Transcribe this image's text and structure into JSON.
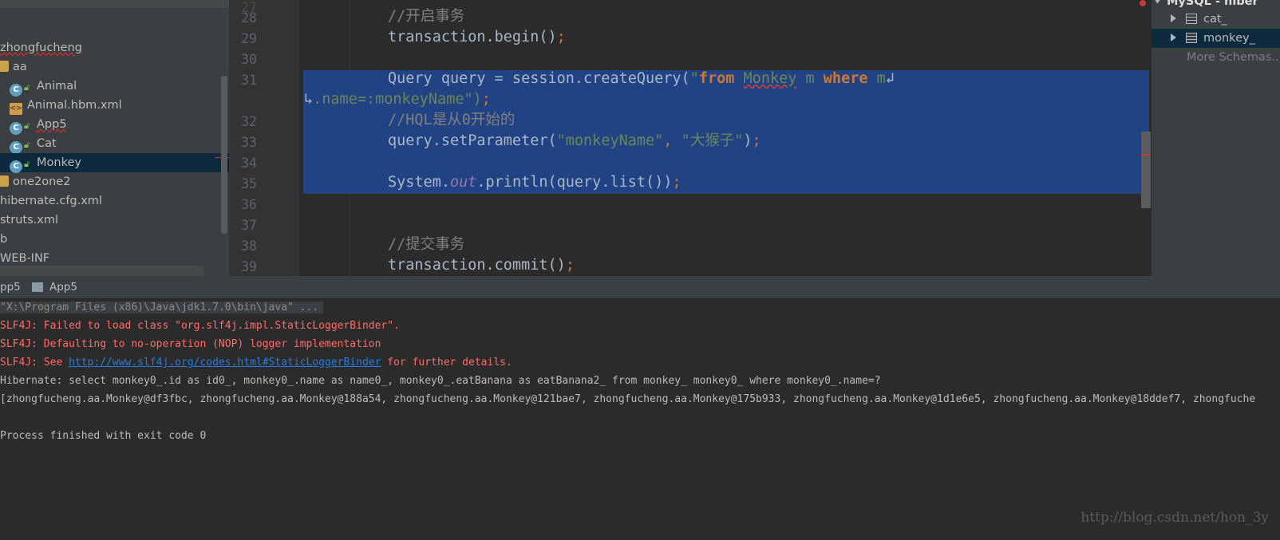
{
  "project_tree": {
    "items": [
      {
        "label": "zhongfucheng"
      },
      {
        "label": "aa"
      },
      {
        "label": "Animal",
        "badge": "C"
      },
      {
        "label": "Animal.hbm.xml"
      },
      {
        "label": "App5",
        "badge": "C"
      },
      {
        "label": "Cat",
        "badge": "C"
      },
      {
        "label": "Monkey",
        "badge": "C"
      },
      {
        "label": "one2one2"
      },
      {
        "label": "hibernate.cfg.xml"
      },
      {
        "label": "struts.xml"
      },
      {
        "label": "b"
      },
      {
        "label": "WEB-INF"
      }
    ]
  },
  "editor": {
    "line_numbers": [
      "28",
      "29",
      "30",
      "31",
      "",
      "32",
      "33",
      "34",
      "35",
      "36",
      "37",
      "38",
      "39"
    ],
    "lines": {
      "l28": "//开启事务",
      "l29_a": "transaction.begin()",
      "l29_b": ";",
      "l31_a": "Query query = session.createQuery(",
      "l31_str1": "\"",
      "l31_kw1": "from",
      "l31_str2": " ",
      "l31_monkey": "Monkey",
      "l31_str3": " m ",
      "l31_kw2": "where",
      "l31_str4": " m",
      "l31_wrap": "↲",
      "l31b_wrap": "↳",
      "l31b_str": ".name=:",
      "l31b_param": "monkeyName",
      "l31b_end": "\")",
      "l31b_semi": ";",
      "l32": "//HQL是从0开始的",
      "l33_a": "query.setParameter(",
      "l33_s1": "\"monkeyName\"",
      "l33_c": ", ",
      "l33_s2": "\"大猴子\"",
      "l33_b": ")",
      "l33_semi": ";",
      "l35_a": "System.",
      "l35_out": "out",
      "l35_b": ".println(query.list())",
      "l35_semi": ";",
      "l38": "//提交事务",
      "l39_a": "transaction.commit()",
      "l39_semi": ";"
    }
  },
  "db_panel": {
    "header": "MySQL - hiber",
    "tables": [
      "cat_",
      "monkey_"
    ],
    "more": "More Schemas..."
  },
  "run_panel": {
    "tabs": [
      "pp5",
      "App5"
    ],
    "output": {
      "cmd": "\"X:\\Program Files (x86)\\Java\\jdk1.7.0\\bin\\java\" ...",
      "err1": "SLF4J: Failed to load class \"org.slf4j.impl.StaticLoggerBinder\".",
      "err2": "SLF4J: Defaulting to no-operation (NOP) logger implementation",
      "err3_a": "SLF4J: See ",
      "err3_link": "http://www.slf4j.org/codes.html#StaticLoggerBinder",
      "err3_b": " for further details.",
      "sql": "Hibernate: select monkey0_.id as id0_, monkey0_.name as name0_, monkey0_.eatBanana as eatBanana2_ from monkey_ monkey0_ where monkey0_.name=?",
      "list": "[zhongfucheng.aa.Monkey@df3fbc, zhongfucheng.aa.Monkey@188a54, zhongfucheng.aa.Monkey@121bae7, zhongfucheng.aa.Monkey@175b933, zhongfucheng.aa.Monkey@1d1e6e5, zhongfucheng.aa.Monkey@18ddef7, zhongfuche",
      "exit": "Process finished with exit code 0"
    }
  },
  "watermark": "http://blog.csdn.net/hon_3y",
  "colors": {
    "selection": "#214283",
    "keyword": "#cc7832",
    "string": "#6a8759",
    "comment": "#808080",
    "error_text": "#ff6b68",
    "link": "#287bde"
  }
}
